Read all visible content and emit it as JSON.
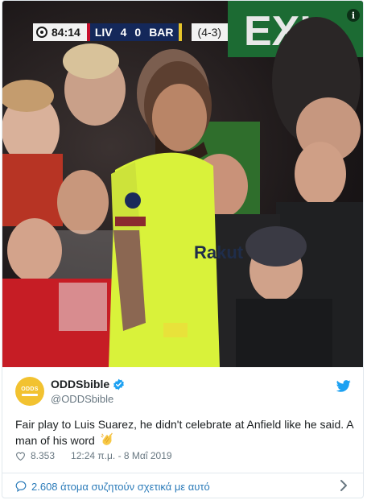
{
  "media": {
    "scorebug": {
      "time": "84:14",
      "home_team": "LIV",
      "home_score": "4",
      "away_score": "0",
      "away_team": "BAR",
      "aggregate": "(4-3)"
    },
    "info_glyph": "i",
    "background_sign": "EXI",
    "shirt_sponsor": "Rakut",
    "colors": {
      "scorebug_bg": "#14285a",
      "liv_red": "#c8102e",
      "kit_yellow": "#d9f23a"
    }
  },
  "tweet": {
    "avatar_text": "ODDS",
    "display_name": "ODDSbible",
    "handle": "@ODDSbible",
    "text": "Fair play to Luis Suarez, he didn't celebrate at Anfield like he said. A man of his word",
    "likes": "8.353",
    "time": "12:24 π.μ. - 8 Μαΐ 2019",
    "conversation_label": "2.608 άτομα συζητούν σχετικά με αυτό"
  },
  "icons": [
    "info-icon",
    "verified-badge-icon",
    "twitter-bird-icon",
    "clapping-hands-emoji",
    "heart-icon",
    "comment-bubble-icon",
    "chevron-right-icon"
  ],
  "colors": {
    "link_blue": "#2b7bb9",
    "verified_blue": "#1da1f2",
    "muted_text": "#697882",
    "avatar_yellow": "#f2c230"
  }
}
